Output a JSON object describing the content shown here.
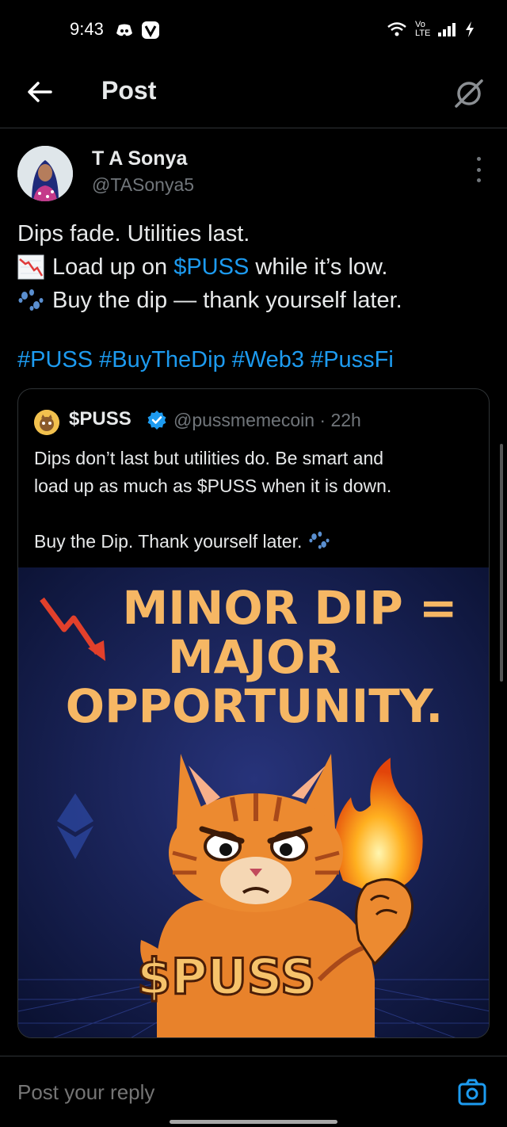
{
  "status_bar": {
    "time": "9:43",
    "icons": [
      "discord-icon",
      "v-app-icon",
      "wifi-icon",
      "volte-icon",
      "signal-icon",
      "charging-icon"
    ],
    "volte_label": "Vo LTE"
  },
  "header": {
    "title": "Post"
  },
  "post": {
    "author_name": "T A Sonya",
    "author_handle": "@TASonya5",
    "line1": "Dips fade. Utilities last.",
    "line2_prefix": "Load up on ",
    "line2_cashtag": "$PUSS",
    "line2_suffix": " while it’s low.",
    "line3": "Buy the dip — thank yourself later.",
    "hashtags": [
      "#PUSS",
      "#BuyTheDip",
      "#Web3",
      "#PussFi"
    ]
  },
  "quote": {
    "author_name": "$PUSS",
    "meta": "@pussmemecoin · 22h",
    "line1": "Dips don’t last but utilities do. Be smart and",
    "line2": "load up as much as $PUSS when it is down.",
    "line3": "Buy the Dip. Thank yourself later.",
    "image": {
      "headline": [
        "MINOR DIP =",
        "MAJOR",
        "OPPORTUNITY."
      ],
      "brand": "$PUSS"
    }
  },
  "reply": {
    "placeholder": "Post your reply"
  },
  "colors": {
    "accent": "#1d9bf0",
    "background": "#000000",
    "text": "#e7e9ea",
    "muted": "#71767b",
    "border": "#2f3336"
  }
}
